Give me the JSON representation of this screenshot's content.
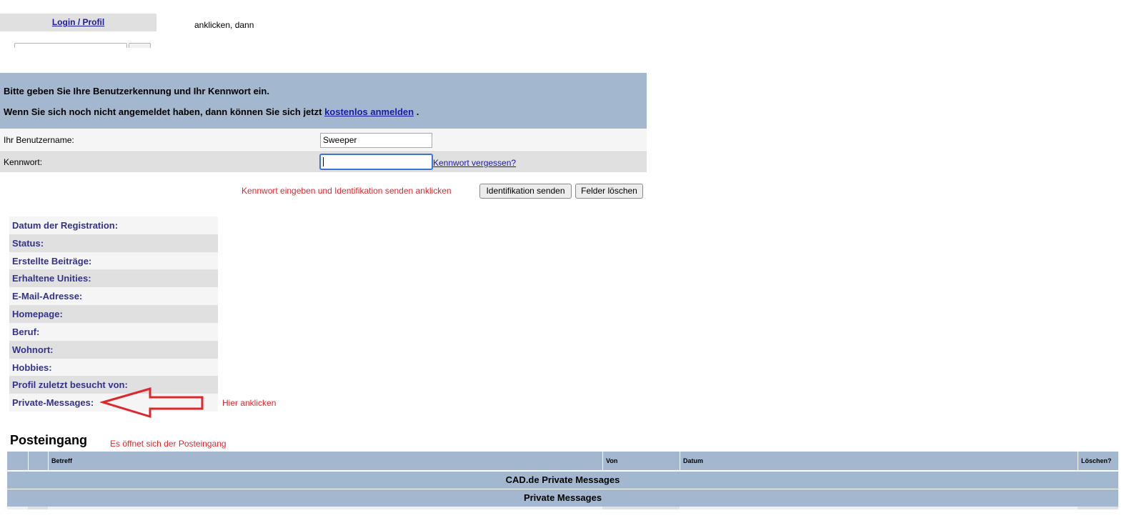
{
  "top": {
    "login_tab": "Login / Profil",
    "instruction": "anklicken, dann"
  },
  "login_panel": {
    "line1": "Bitte geben Sie Ihre Benutzerkennung und Ihr Kennwort ein.",
    "line2_prefix": "Wenn Sie sich noch nicht angemeldet haben, dann können Sie sich jetzt",
    "line2_link": "kostenlos anmelden",
    "line2_suffix": ".",
    "username_label": "Ihr Benutzername:",
    "username_value": "Sweeper",
    "password_label": "Kennwort:",
    "password_value": "",
    "forgot_link": "Kennwort vergessen?",
    "hint": "Kennwort eingeben und Identifikation senden anklicken",
    "send_button": "Identifikation senden",
    "clear_button": "Felder löschen"
  },
  "profile": {
    "fields": [
      "Datum der Registration:",
      "Status:",
      "Erstellte Beiträge:",
      "Erhaltene Unities:",
      "E-Mail-Adresse:",
      "Homepage:",
      "Beruf:",
      "Wohnort:",
      "Hobbies:",
      "Profil zuletzt besucht von:",
      "Private-Messages:"
    ],
    "hint": "Hier anklicken"
  },
  "inbox": {
    "title": "Posteingang",
    "hint": "Es öffnet sich der Posteingang",
    "columns": [
      "",
      "",
      "Betreff",
      "Von",
      "Datum",
      "Löschen?"
    ],
    "banner1": "CAD.de Private Messages",
    "banner2": "Private Messages"
  },
  "colors": {
    "panel_blue": "#a3b8cf",
    "row_light": "#f5f5f5",
    "row_dark": "#e0e0e0",
    "profile_label": "#33338c",
    "annotation_red": "#e0262b",
    "link": "#1a1aa6"
  }
}
